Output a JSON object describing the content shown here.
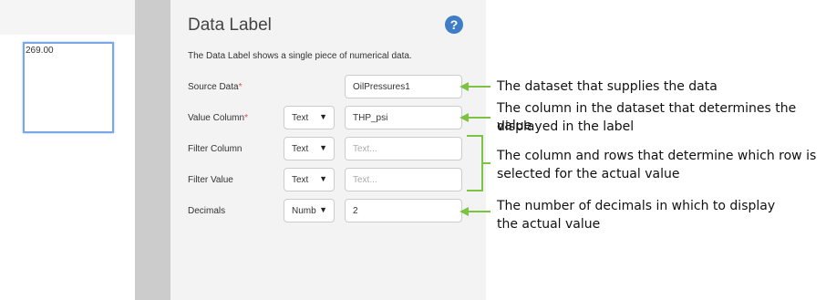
{
  "canvas": {
    "widget_value": "269.00"
  },
  "panel": {
    "title": "Data Label",
    "description": "The Data Label shows a single piece of numerical data.",
    "help_icon": "question-circle-icon",
    "rows": {
      "source_data": {
        "label": "Source Data",
        "required_mark": "*",
        "value": "OilPressures1"
      },
      "value_column": {
        "label": "Value Column",
        "required_mark": "*",
        "type": "Text",
        "value": "THP_psi"
      },
      "filter_column": {
        "label": "Filter Column",
        "type": "Text",
        "placeholder": "Text..."
      },
      "filter_value": {
        "label": "Filter Value",
        "type": "Text",
        "placeholder": "Text..."
      },
      "decimals": {
        "label": "Decimals",
        "type": "Numb",
        "value": "2"
      }
    }
  },
  "annotations": {
    "source": "The dataset that supplies the data",
    "value_line1": "The column in the dataset that determines the value",
    "value_line2": "displayed in the label",
    "filter_line1": "The column and rows that determine which row is",
    "filter_line2": "selected for the actual value",
    "decimals_line1": "The number of decimals in which to display",
    "decimals_line2": "the actual value"
  },
  "colors": {
    "arrow": "#7dc242",
    "help_icon": "#3f7dc7",
    "panel_bg": "#f3f3f3",
    "gutter": "#cccccc",
    "selection_border": "#7aa7e8"
  }
}
